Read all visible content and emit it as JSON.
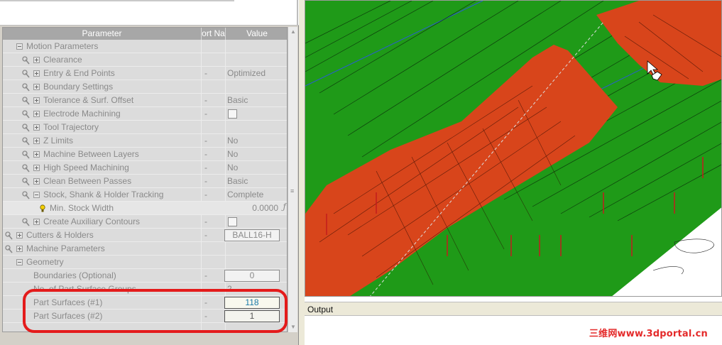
{
  "grid": {
    "headers": {
      "parameter": "Parameter",
      "sort": "ort Na",
      "value": "Value"
    },
    "rows": [
      {
        "label": "Motion Parameters",
        "sort": "",
        "value": ""
      },
      {
        "label": "Clearance",
        "sort": "",
        "value": ""
      },
      {
        "label": "Entry & End Points",
        "sort": "-",
        "value": "Optimized"
      },
      {
        "label": "Boundary Settings",
        "sort": "",
        "value": ""
      },
      {
        "label": "Tolerance & Surf. Offset",
        "sort": "-",
        "value": "Basic"
      },
      {
        "label": "Electrode Machining",
        "sort": "-",
        "value": ""
      },
      {
        "label": "Tool Trajectory",
        "sort": "",
        "value": ""
      },
      {
        "label": "Z Limits",
        "sort": "-",
        "value": "No"
      },
      {
        "label": "Machine Between Layers",
        "sort": "-",
        "value": "No"
      },
      {
        "label": "High Speed Machining",
        "sort": "-",
        "value": "No"
      },
      {
        "label": "Clean Between Passes",
        "sort": "-",
        "value": "Basic"
      },
      {
        "label": "Stock, Shank & Holder Tracking",
        "sort": "-",
        "value": "Complete"
      },
      {
        "label": "Min. Stock Width",
        "sort": "",
        "value": "0.0000",
        "glyph": "ƒ"
      },
      {
        "label": "Create Auxiliary Contours",
        "sort": "-",
        "value": ""
      },
      {
        "label": "Cutters & Holders",
        "sort": "-",
        "value": "BALL16-H"
      },
      {
        "label": "Machine Parameters",
        "sort": "",
        "value": ""
      },
      {
        "label": "Geometry",
        "sort": "",
        "value": ""
      },
      {
        "label": "Boundaries (Optional)",
        "sort": "-",
        "value": "0"
      },
      {
        "label": "No. of Part Surface Groups",
        "sort": "",
        "value": "2"
      },
      {
        "label": "Part Surfaces (#1)",
        "sort": "-",
        "value": "118"
      },
      {
        "label": "Part Surfaces (#2)",
        "sort": "-",
        "value": "1"
      }
    ]
  },
  "output": {
    "title": "Output"
  },
  "watermark": "三维网www.3dportal.cn",
  "colors": {
    "surface_green": "#1f9a18",
    "part_orange": "#d8451b",
    "highlight_red": "#e41b1b"
  }
}
